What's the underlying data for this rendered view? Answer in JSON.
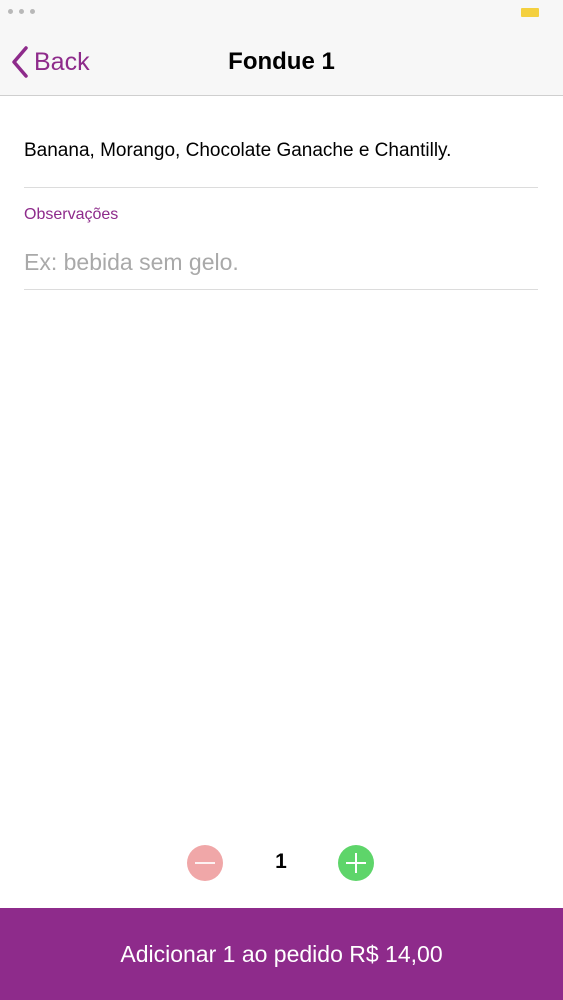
{
  "colors": {
    "accent": "#8e2b8b",
    "minus": "#f0a7a8",
    "plus": "#5ed56a",
    "battery": "#f4d03f"
  },
  "nav": {
    "back_label": "Back",
    "title": "Fondue 1"
  },
  "item": {
    "description": "Banana, Morango, Chocolate Ganache e Chantilly."
  },
  "observations": {
    "label": "Observações",
    "value": "",
    "placeholder": "Ex: bebida sem gelo."
  },
  "quantity": {
    "value": "1",
    "minus_icon": "minus-circle-icon",
    "plus_icon": "plus-circle-icon"
  },
  "add_button": {
    "label": "Adicionar 1 ao pedido R$ 14,00"
  }
}
